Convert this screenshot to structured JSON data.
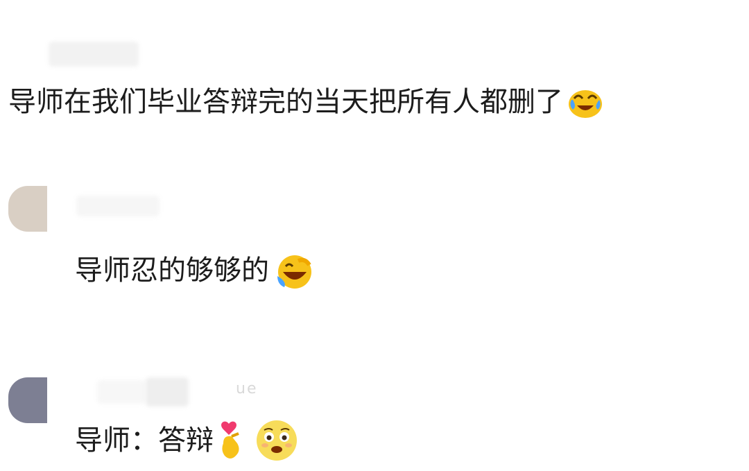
{
  "comments": [
    {
      "text": "导师在我们毕业答辩完的当天把所有人都删了",
      "emoji": "crying-laughing-emoji-icon"
    },
    {
      "text": "导师忍的够够的",
      "emoji": "rolling-laughing-emoji-icon"
    },
    {
      "text": "导师：答辩",
      "emoji_1": "finger-heart-emoji-icon",
      "emoji_2": "pleading-face-emoji-icon"
    }
  ],
  "ghost_username_fragment": "ue",
  "colors": {
    "background": "#ffffff",
    "text": "#1c1c1c",
    "avatar_1": "#d9cfc4",
    "avatar_2": "#7d7f93",
    "emoji_yellow": "#f7c21a",
    "tear_blue": "#4aa3ff"
  }
}
